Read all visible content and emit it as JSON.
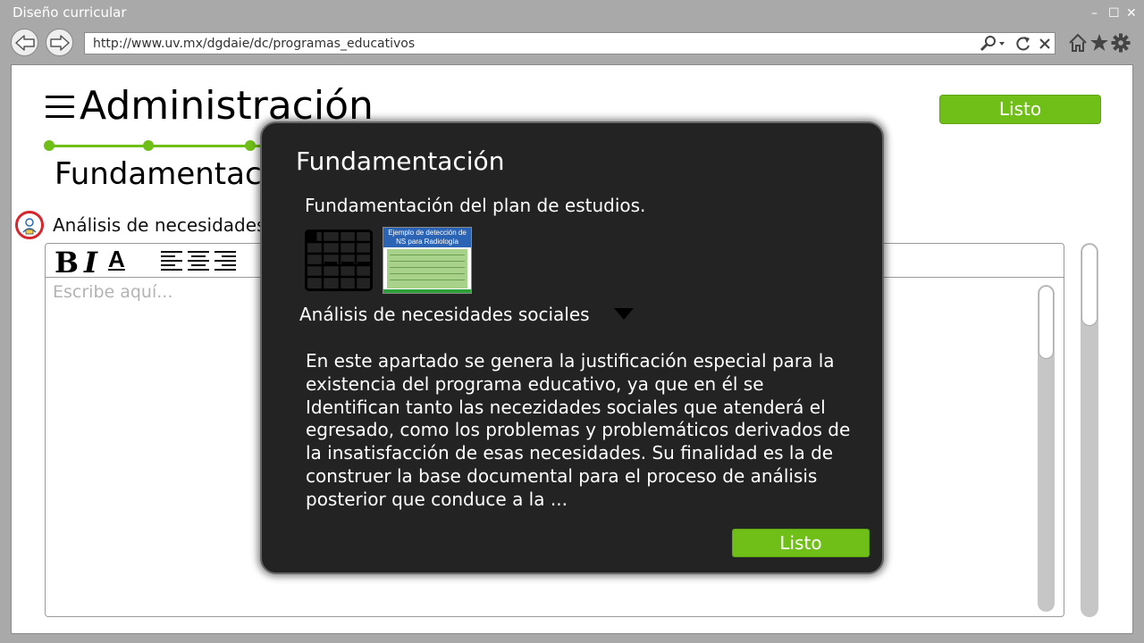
{
  "window": {
    "title": "Diseño curricular",
    "controls": [
      "–",
      "☐",
      "✕"
    ]
  },
  "browser": {
    "url": "http://www.uv.mx/dgdaie/dc/programas_educativos",
    "icons": [
      "back-arrow-icon",
      "forward-arrow-icon",
      "search-icon",
      "reload-icon",
      "close-icon",
      "home-icon",
      "star-icon",
      "gear-icon"
    ]
  },
  "page": {
    "title": "Administración",
    "done_button": "Listo",
    "section_title": "Fundamentación",
    "section_subtitle": "Análisis de necesidades sociales",
    "editor": {
      "bold": "B",
      "italic": "I",
      "underline": "A",
      "placeholder": "Escribe aquí..."
    }
  },
  "modal": {
    "title": "Fundamentación",
    "subtitle": "Fundamentación  del plan de estudios.",
    "thumbnail_caption": "Ejemplo de detección de NS para Radiología",
    "dropdown_value": "Análisis de necesidades  sociales",
    "body": "En este apartado se genera la justificación especial para la existencia del programa educativo, ya que en él se Identifican tanto las necezidades sociales que atenderá  el egresado, como los problemas y problemáticos derivados de la insatisfacción de esas necesidades. Su finalidad es la de construer  la base documental  para el proceso de análisis posterior que conduce a la ...",
    "done_button": "Listo"
  },
  "colors": {
    "accent_green": "#6fbf18",
    "modal_bg": "#232323",
    "chrome_gray": "#a9a9a9"
  }
}
